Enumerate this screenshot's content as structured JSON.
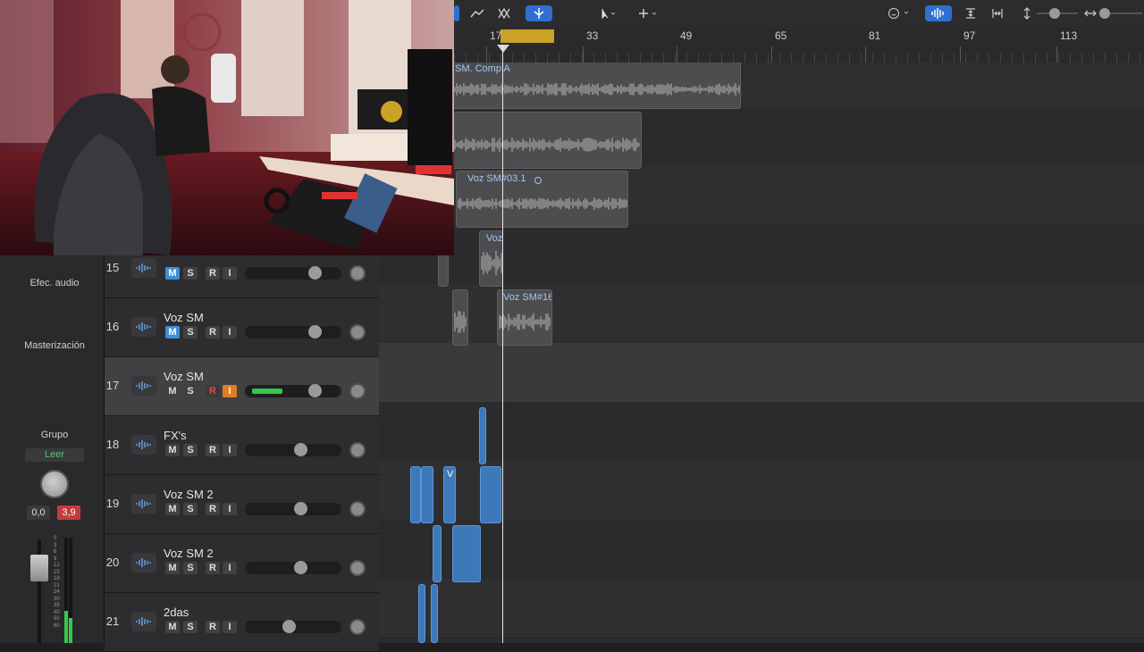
{
  "toolbar": {
    "tools": [
      "automation-curve-icon",
      "flex-icon",
      "catch-icon"
    ],
    "pointer_tool": "pointer-icon",
    "pencil_tool": "plus-crosshair-icon",
    "smart_icon": "smiley-icon",
    "waveform_zoom": "waveform-icon",
    "vertical_zoom_icon": "vertical-fit-icon",
    "horizontal_fit_icon": "horizontal-fit-icon"
  },
  "ruler": {
    "bars": [
      "17",
      "33",
      "49",
      "65",
      "81",
      "97",
      "113"
    ]
  },
  "inspector": {
    "audio_fx": "Efec. audio",
    "mastering": "Masterización",
    "group": "Grupo",
    "read": "Leer",
    "value_left": "0,0",
    "value_right": "3,9"
  },
  "tracks": [
    {
      "number": "15",
      "name": "",
      "m_active": true,
      "selected": false,
      "volume": 0.72
    },
    {
      "number": "16",
      "name": "Voz SM",
      "m_active": true,
      "selected": false,
      "volume": 0.72
    },
    {
      "number": "17",
      "name": "Voz SM",
      "m_active": false,
      "selected": true,
      "volume": 0.72,
      "record_armed": true
    },
    {
      "number": "18",
      "name": "FX's",
      "m_active": false,
      "selected": false,
      "volume": 0.57
    },
    {
      "number": "19",
      "name": "Voz SM 2",
      "m_active": false,
      "selected": false,
      "volume": 0.57
    },
    {
      "number": "20",
      "name": "Voz SM 2",
      "m_active": false,
      "selected": false,
      "volume": 0.57
    },
    {
      "number": "21",
      "name": "2das",
      "m_active": false,
      "selected": false,
      "volume": 0.45
    }
  ],
  "buttons": {
    "m": "M",
    "s": "S",
    "r": "R",
    "i": "I"
  },
  "regions": {
    "comp": "SM. Comp A",
    "voz_03": "Voz SM#03.1",
    "voz_short": "Voz",
    "voz_16": "Voz SM#16",
    "v": "V"
  },
  "colors": {
    "accent_blue": "#2f6fd1",
    "cycle_yellow": "#c9a227",
    "input_orange": "#e07c22",
    "record_red": "#e04a4a",
    "meter_green": "#36c84a"
  }
}
